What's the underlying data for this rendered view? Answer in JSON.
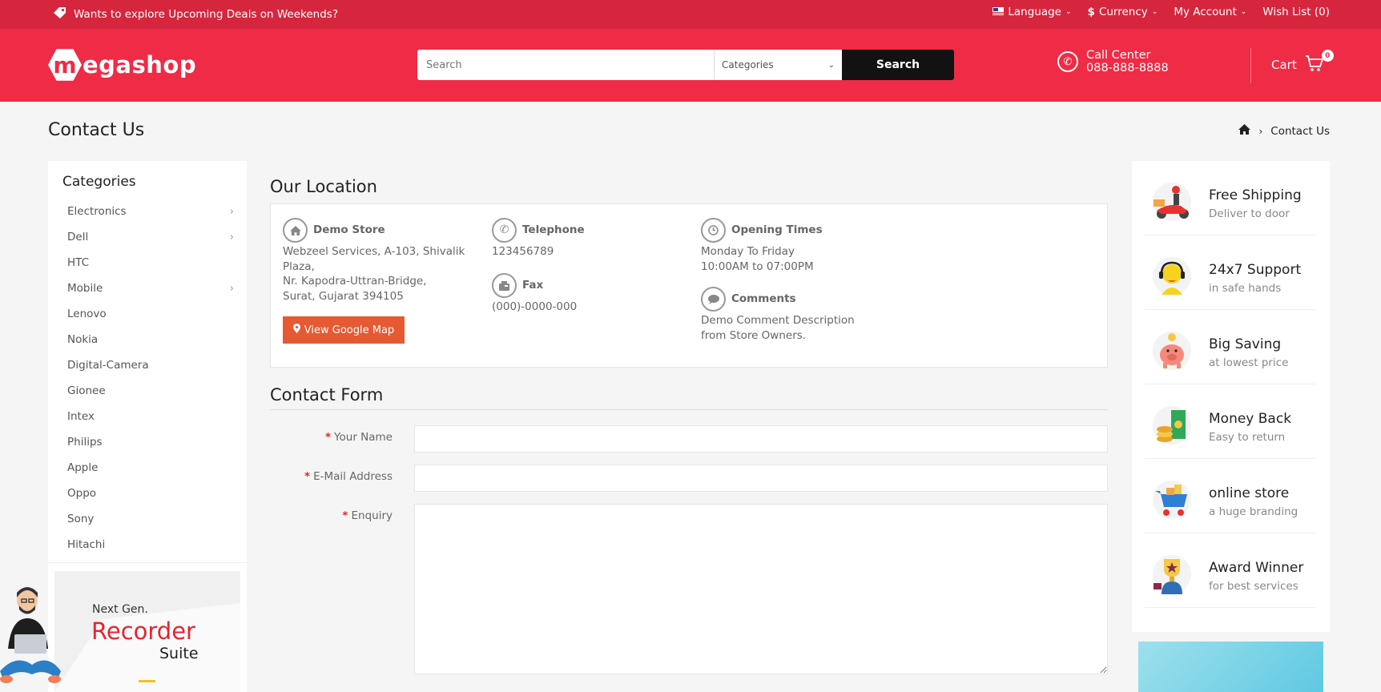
{
  "topbar": {
    "promo": "Wants to explore Upcoming Deals on Weekends?",
    "language": "Language",
    "currency": "Currency",
    "account": "My Account",
    "wishlist": "Wish List (0)"
  },
  "header": {
    "logo_m": "m",
    "logo_rest": "egashop",
    "search_placeholder": "Search",
    "categories_label": "Categories",
    "search_button": "Search",
    "call_label": "Call Center",
    "call_number": "088-888-8888",
    "cart_label": "Cart",
    "cart_count": "0"
  },
  "page": {
    "title": "Contact Us",
    "breadcrumb_current": "Contact Us"
  },
  "sidebar": {
    "heading": "Categories",
    "items": [
      {
        "label": "Electronics",
        "has_sub": true
      },
      {
        "label": "Dell",
        "has_sub": true
      },
      {
        "label": "HTC",
        "has_sub": false
      },
      {
        "label": "Mobile",
        "has_sub": true
      },
      {
        "label": "Lenovo",
        "has_sub": false
      },
      {
        "label": "Nokia",
        "has_sub": false
      },
      {
        "label": "Digital-Camera",
        "has_sub": false
      },
      {
        "label": "Gionee",
        "has_sub": false
      },
      {
        "label": "Intex",
        "has_sub": false
      },
      {
        "label": "Philips",
        "has_sub": false
      },
      {
        "label": "Apple",
        "has_sub": false
      },
      {
        "label": "Oppo",
        "has_sub": false
      },
      {
        "label": "Sony",
        "has_sub": false
      },
      {
        "label": "Hitachi",
        "has_sub": false
      }
    ],
    "banner": {
      "line1": "Next Gen.",
      "line2": "Recorder",
      "line3": "Suite"
    }
  },
  "location": {
    "heading": "Our Location",
    "store_name": "Demo Store",
    "address_lines": [
      "Webzeel Services, A-103, Shivalik",
      "Plaza,",
      "Nr. Kapodra-Uttran-Bridge,",
      "Surat, Gujarat 394105"
    ],
    "map_button": "View Google Map",
    "telephone_label": "Telephone",
    "telephone": "123456789",
    "fax_label": "Fax",
    "fax": "(000)-0000-000",
    "opening_label": "Opening Times",
    "opening_lines": [
      "Monday To Friday",
      "10:00AM to 07:00PM"
    ],
    "comments_label": "Comments",
    "comments_lines": [
      "Demo Comment Description",
      "from Store Owners."
    ]
  },
  "form": {
    "heading": "Contact Form",
    "name_label": "Your Name",
    "email_label": "E-Mail Address",
    "enquiry_label": "Enquiry",
    "required_mark": "*"
  },
  "features": [
    {
      "title": "Free Shipping",
      "subtitle": "Deliver to door",
      "icon": "scooter-delivery-icon"
    },
    {
      "title": "24x7 Support",
      "subtitle": "in safe hands",
      "icon": "support-headset-icon"
    },
    {
      "title": "Big Saving",
      "subtitle": "at lowest price",
      "icon": "piggy-bank-icon"
    },
    {
      "title": "Money Back",
      "subtitle": "Easy to return",
      "icon": "money-back-icon"
    },
    {
      "title": "online store",
      "subtitle": "a huge branding",
      "icon": "shopping-cart-icon"
    },
    {
      "title": "Award Winner",
      "subtitle": "for best services",
      "icon": "trophy-icon"
    }
  ],
  "colors": {
    "topbar": "#d6263e",
    "header": "#ef2b45",
    "search_button": "#121212",
    "map_button": "#e55a33",
    "required": "#e8232f"
  }
}
